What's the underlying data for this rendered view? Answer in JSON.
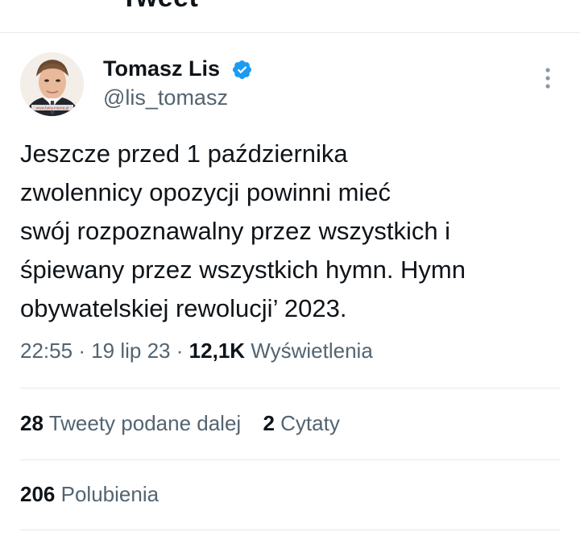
{
  "header": {
    "title": "Tweet"
  },
  "author": {
    "name": "Tomasz Lis",
    "handle": "@lis_tomasz",
    "verified": true,
    "badge_color": "#1d9bf0",
    "avatar_watermark": "www.fakty.interia.pl"
  },
  "tweet": {
    "lines": [
      "Jeszcze przed 1 października",
      "zwolennicy opozycji powinni mieć",
      "swój rozpoznawalny przez wszystkich i",
      "śpiewany przez wszystkich hymn. Hymn",
      "obywatelskiej rewolucji’ 2023."
    ],
    "time": "22:55",
    "separator": "·",
    "date": "19 lip 23",
    "views_count": "12,1K",
    "views_label": "Wyświetlenia"
  },
  "stats": {
    "retweets_count": "28",
    "retweets_label": "Tweety podane dalej",
    "quotes_count": "2",
    "quotes_label": "Cytaty",
    "likes_count": "206",
    "likes_label": "Polubienia"
  },
  "colors": {
    "text_primary": "#0f1419",
    "text_secondary": "#536471",
    "divider": "#e3e7ea",
    "verified": "#1d9bf0"
  },
  "icons": {
    "back": "back-arrow-icon",
    "verified": "verified-badge-icon",
    "more": "more-vertical-icon"
  }
}
